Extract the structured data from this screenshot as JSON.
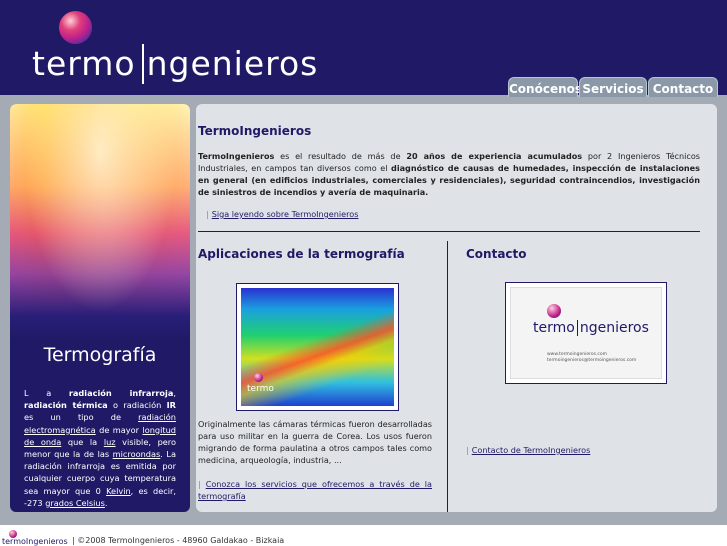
{
  "header": {
    "logo_left": "termo",
    "logo_right": "ngenieros",
    "nav": [
      {
        "label": "Conócenos"
      },
      {
        "label": "Servicios"
      },
      {
        "label": "Contacto"
      }
    ]
  },
  "sidebar": {
    "title": "Termografía",
    "text_parts": {
      "p1": "L a ",
      "b1": "radiación infrarroja",
      "p2": ", ",
      "b2": "radiación térmica",
      "p3": " o radiación ",
      "b3": "IR",
      "p4": " es un tipo de ",
      "l1": "radiación electromagnética",
      "p5": " de mayor ",
      "l2": "longitud de onda",
      "p6": " que la ",
      "l3": "luz",
      "p7": " visible, pero menor que la de las ",
      "l4": "microondas",
      "p8": ". La radiación infrarroja es emitida por cualquier cuerpo cuya temperatura sea mayor que 0 ",
      "l5": "Kelvin",
      "p9": ", es decir, -273 ",
      "l6": "grados Celsius",
      "p10": "."
    }
  },
  "intro": {
    "title": "TermoIngenieros",
    "b1": "TermoIngenieros",
    "p1": " es el resultado de más de ",
    "b2": "20 años de experiencia acumulados",
    "p2": " por 2 Ingenieros Técnicos Industriales, en campos tan diversos como el ",
    "b3": "diagnóstico de causas de humedades, inspección de instalaciones en general (en edificios industriales, comerciales y residenciales), seguridad contraincendios, investigación de siniestros de incendios y avería de maquinaria.",
    "link": "Siga leyendo sobre TermoIngenieros"
  },
  "aplicaciones": {
    "title": "Aplicaciones de la termografía",
    "image_logo": "termo",
    "text": "Originalmente las cámaras térmicas fueron desarrolladas para uso militar en la guerra de Corea. Los usos fueron migrando de forma paulatina a otros campos tales como medicina, arqueología, industria, ...",
    "link": "Conozca los servicios que ofrecemos a través de la termografía"
  },
  "contacto": {
    "title": "Contacto",
    "card_left": "termo",
    "card_right": "ngenieros",
    "card_line1": "www.termoingenieros.com",
    "card_line2": "termoingenieros@termoingenieros.com",
    "link": "Contacto de TermoIngenieros"
  },
  "footer": {
    "logo": "termoIngenieros",
    "text": "| ©2008 TermoIngenieros - 48960 Galdakao - Bizkaia"
  }
}
